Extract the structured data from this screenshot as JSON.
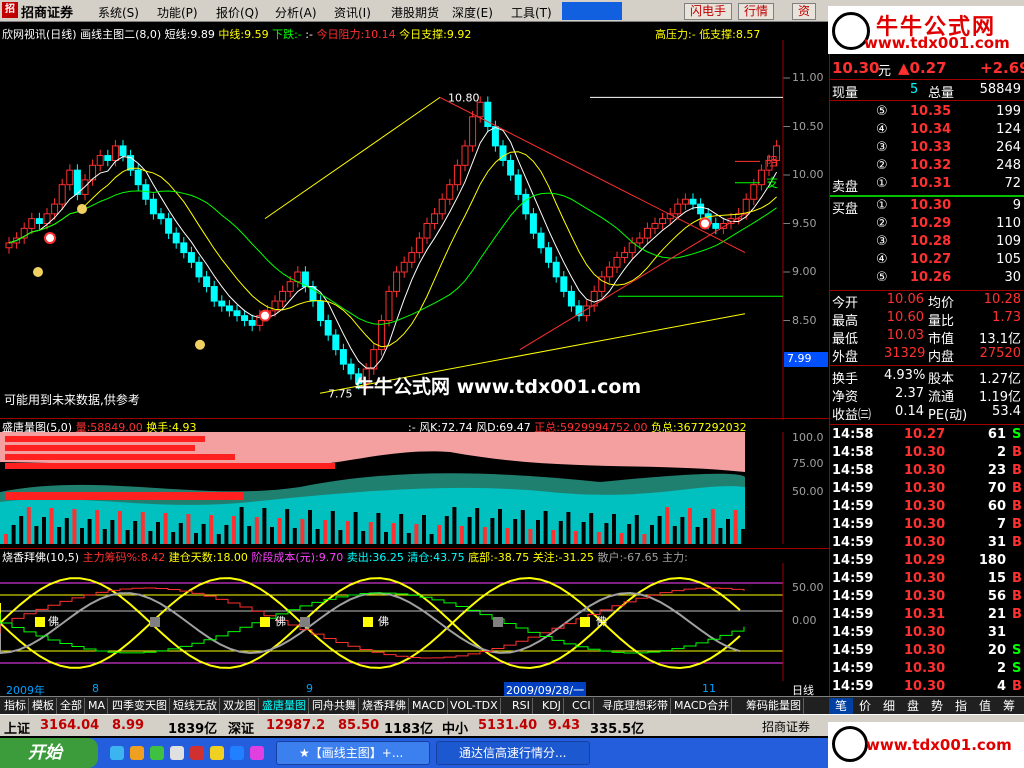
{
  "menubar": {
    "brand": "招商证券",
    "items": [
      "系统(S)",
      "功能(P)",
      "报价(Q)",
      "分析(A)",
      "资讯(I)",
      "港股期货",
      "深度(E)",
      "工具(T)"
    ],
    "buttons": [
      "闪电手",
      "行情",
      "资"
    ]
  },
  "banner": {
    "title": "牛牛公式网",
    "url": "www.tdx001.com"
  },
  "chart_header": {
    "stock": "欣网视讯(日线)",
    "indicator": "画线主图二(8,0)",
    "short_line": "短线:9.89",
    "mid_line": "中线:9.59",
    "down": "下跌:-",
    "colon": ":-",
    "resist_today": "今日阻力:10.14",
    "support_today": "今日支撑:9.92",
    "high_pressure": "高压力:-",
    "low_support": "低支撑:8.57"
  },
  "main_chart": {
    "watermark": "牛牛公式网 www.tdx001.com",
    "disclaimer": "可能用到未来数据,供参考",
    "high_label": "10.80",
    "low_label": "7.75",
    "resist_tag": "阻",
    "support_tag": "支",
    "price_tag": "7.99",
    "y_ticks": [
      "11.00",
      "10.50",
      "10.00",
      "9.50",
      "9.00",
      "8.50"
    ]
  },
  "panel2": {
    "title": "盛唐量图(5,0)",
    "volume": "量:58849.00",
    "turnover": "换手:4.93",
    "colon": ":-",
    "k": "风K:72.74",
    "d": "风D:69.47",
    "pos_total": "正总:5929994752.00",
    "neg_total": "负总:3677292032",
    "y_ticks": [
      "100.0",
      "75.00",
      "50.00"
    ]
  },
  "panel3": {
    "title": "烧香拜佛(10,5)",
    "main_cost": "主力筹码%:8.42",
    "build_days": "建仓天数:18.00",
    "stage_cost": "阶段成本(元):9.70",
    "sell": "卖出:36.25",
    "clear": "清仓:43.75",
    "bottom": "底部:-38.75",
    "watch": "关注:-31.25",
    "retail": "散户:-67.65",
    "main_force": "主力:",
    "y_ticks": [
      "50.00",
      "0.00"
    ],
    "buddha": "佛"
  },
  "date_axis": {
    "labels": [
      "2009年",
      "8",
      "9",
      "2009/09/28/一",
      "11",
      "日线"
    ]
  },
  "bottom_tabs": [
    "指标",
    "模板",
    "全部",
    "MA",
    "四季变天图",
    "短线无敌",
    "双龙图",
    "盛唐量图",
    "同舟共舞",
    "烧香拜佛",
    "MACD",
    "VOL-TDX",
    "RSI",
    "KDJ",
    "CCI",
    "寻底理想彩带",
    "MACD合并",
    "筹码能量图"
  ],
  "active_tab": "盛唐量图",
  "quote": {
    "price": "10.30",
    "unit": "元",
    "change": "▲0.27",
    "change_pct": "+2.69",
    "current_vol_label": "现量",
    "current_vol": "5",
    "total_vol_label": "总量",
    "total_vol": "58849",
    "asks": [
      {
        "level": "⑤",
        "price": "10.35",
        "vol": "199"
      },
      {
        "level": "④",
        "price": "10.34",
        "vol": "124"
      },
      {
        "level": "③",
        "price": "10.33",
        "vol": "264"
      },
      {
        "level": "②",
        "price": "10.32",
        "vol": "248"
      },
      {
        "level": "①",
        "price": "10.31",
        "vol": "72",
        "label": "卖盘"
      }
    ],
    "bids": [
      {
        "level": "①",
        "price": "10.30",
        "vol": "9",
        "label": "买盘"
      },
      {
        "level": "②",
        "price": "10.29",
        "vol": "110"
      },
      {
        "level": "③",
        "price": "10.28",
        "vol": "109"
      },
      {
        "level": "④",
        "price": "10.27",
        "vol": "105"
      },
      {
        "level": "⑤",
        "price": "10.26",
        "vol": "30"
      }
    ],
    "stats": [
      {
        "l1": "今开",
        "v1": "10.06",
        "l2": "均价",
        "v2": "10.28"
      },
      {
        "l1": "最高",
        "v1": "10.60",
        "l2": "量比",
        "v2": "1.73"
      },
      {
        "l1": "最低",
        "v1": "10.03",
        "l2": "市值",
        "v2": "13.1亿"
      },
      {
        "l1": "外盘",
        "v1": "31329",
        "l2": "内盘",
        "v2": "27520"
      }
    ],
    "stats2": [
      {
        "l1": "换手",
        "v1": "4.93%",
        "l2": "股本",
        "v2": "1.27亿"
      },
      {
        "l1": "净资",
        "v1": "2.37",
        "l2": "流通",
        "v2": "1.19亿"
      },
      {
        "l1": "收益㈢",
        "v1": "0.14",
        "l2": "PE(动)",
        "v2": "53.4"
      }
    ],
    "ticks": [
      {
        "t": "14:58",
        "p": "10.27",
        "v": "61",
        "f": "S"
      },
      {
        "t": "14:58",
        "p": "10.30",
        "v": "2",
        "f": "B"
      },
      {
        "t": "14:58",
        "p": "10.30",
        "v": "23",
        "f": "B"
      },
      {
        "t": "14:59",
        "p": "10.30",
        "v": "70",
        "f": "B"
      },
      {
        "t": "14:59",
        "p": "10.30",
        "v": "60",
        "f": "B"
      },
      {
        "t": "14:59",
        "p": "10.30",
        "v": "7",
        "f": "B"
      },
      {
        "t": "14:59",
        "p": "10.30",
        "v": "31",
        "f": "B"
      },
      {
        "t": "14:59",
        "p": "10.29",
        "v": "180",
        "f": ""
      },
      {
        "t": "14:59",
        "p": "10.30",
        "v": "15",
        "f": "B"
      },
      {
        "t": "14:59",
        "p": "10.30",
        "v": "56",
        "f": "B"
      },
      {
        "t": "14:59",
        "p": "10.31",
        "v": "21",
        "f": "B"
      },
      {
        "t": "14:59",
        "p": "10.30",
        "v": "31",
        "f": ""
      },
      {
        "t": "14:59",
        "p": "10.30",
        "v": "20",
        "f": "S"
      },
      {
        "t": "14:59",
        "p": "10.30",
        "v": "2",
        "f": "S"
      },
      {
        "t": "14:59",
        "p": "10.30",
        "v": "4",
        "f": "B"
      }
    ]
  },
  "right_tabs": [
    "笔",
    "价",
    "细",
    "盘",
    "势",
    "指",
    "值",
    "筹"
  ],
  "index_bar": {
    "sh_label": "上证",
    "sh_val": "3164.04",
    "sh_chg": "8.99",
    "sh_amt": "1839亿",
    "sz_label": "深证",
    "sz_val": "12987.2",
    "sz_chg": "85.50",
    "sz_amt": "1183亿",
    "zx_label": "中小",
    "zx_val": "5131.40",
    "zx_chg": "9.43",
    "zx_amt": "335.5亿",
    "broker": "招商证券"
  },
  "taskbar": {
    "start": "开始",
    "tasks": [
      "★【画线主图】+...",
      "通达信高速行情分..."
    ]
  },
  "colors": {
    "up": "#ff3030",
    "down": "#00ffff",
    "bg": "#000000",
    "accent": "#ffff00"
  }
}
